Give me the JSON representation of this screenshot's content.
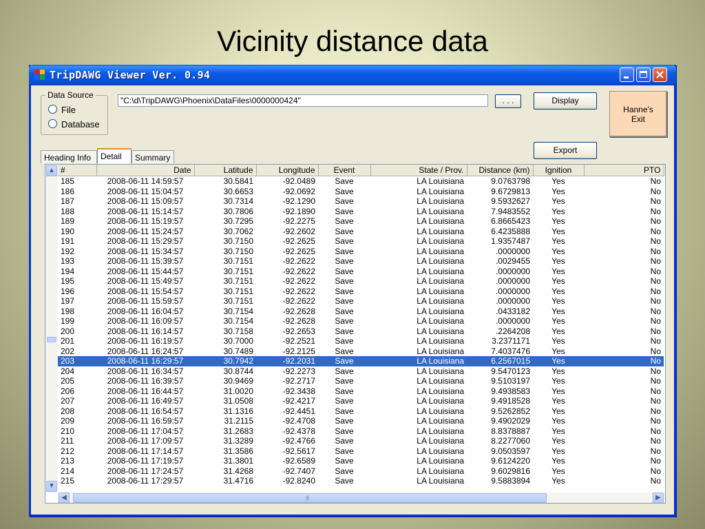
{
  "slide_title": "Vicinity distance data",
  "window": {
    "title": "TripDAWG Viewer  Ver. 0.94",
    "controls": {
      "minimize": "minimize-icon",
      "maximize": "maximize-icon",
      "close": "close-icon"
    }
  },
  "data_source": {
    "label": "Data Source",
    "options": [
      "File",
      "Database"
    ]
  },
  "path_input": {
    "value": "\"C:\\d\\TripDAWG\\Phoenix\\DataFiles\\0000000424\""
  },
  "buttons": {
    "browse": ". . .",
    "display": "Display",
    "exit": "Hanne's Exit",
    "export": "Export"
  },
  "tabs": [
    "Heading Info",
    "Detail",
    "Summary"
  ],
  "active_tab": "Detail",
  "colors": {
    "selection": "#316ac5",
    "exit_button": "#fcd9b6",
    "titlebar": "#0a5fe6"
  },
  "table": {
    "columns": [
      "#",
      "Date",
      "Latitude",
      "Longitude",
      "Event",
      "State / Prov.",
      "Distance (km)",
      "Ignition",
      "PTO"
    ],
    "selected_row": "203",
    "rows": [
      [
        "185",
        "2008-06-11 14:59:57",
        "30.5841",
        "-92.0489",
        "Save",
        "LA Louisiana",
        "9.0763798",
        "Yes",
        "No"
      ],
      [
        "186",
        "2008-06-11 15:04:57",
        "30.6653",
        "-92.0692",
        "Save",
        "LA Louisiana",
        "9.6729813",
        "Yes",
        "No"
      ],
      [
        "187",
        "2008-06-11 15:09:57",
        "30.7314",
        "-92.1290",
        "Save",
        "LA Louisiana",
        "9.5932627",
        "Yes",
        "No"
      ],
      [
        "188",
        "2008-06-11 15:14:57",
        "30.7806",
        "-92.1890",
        "Save",
        "LA Louisiana",
        "7.9483552",
        "Yes",
        "No"
      ],
      [
        "189",
        "2008-06-11 15:19:57",
        "30.7295",
        "-92.2275",
        "Save",
        "LA Louisiana",
        "6.8665423",
        "Yes",
        "No"
      ],
      [
        "190",
        "2008-06-11 15:24:57",
        "30.7062",
        "-92.2602",
        "Save",
        "LA Louisiana",
        "6.4235888",
        "Yes",
        "No"
      ],
      [
        "191",
        "2008-06-11 15:29:57",
        "30.7150",
        "-92.2625",
        "Save",
        "LA Louisiana",
        "1.9357487",
        "Yes",
        "No"
      ],
      [
        "192",
        "2008-06-11 15:34:57",
        "30.7150",
        "-92.2625",
        "Save",
        "LA Louisiana",
        ".0000000",
        "Yes",
        "No"
      ],
      [
        "193",
        "2008-06-11 15:39:57",
        "30.7151",
        "-92.2622",
        "Save",
        "LA Louisiana",
        ".0029455",
        "Yes",
        "No"
      ],
      [
        "194",
        "2008-06-11 15:44:57",
        "30.7151",
        "-92.2622",
        "Save",
        "LA Louisiana",
        ".0000000",
        "Yes",
        "No"
      ],
      [
        "195",
        "2008-06-11 15:49:57",
        "30.7151",
        "-92.2622",
        "Save",
        "LA Louisiana",
        ".0000000",
        "Yes",
        "No"
      ],
      [
        "196",
        "2008-06-11 15:54:57",
        "30.7151",
        "-92.2622",
        "Save",
        "LA Louisiana",
        ".0000000",
        "Yes",
        "No"
      ],
      [
        "197",
        "2008-06-11 15:59:57",
        "30.7151",
        "-92.2622",
        "Save",
        "LA Louisiana",
        ".0000000",
        "Yes",
        "No"
      ],
      [
        "198",
        "2008-06-11 16:04:57",
        "30.7154",
        "-92.2628",
        "Save",
        "LA Louisiana",
        ".0433182",
        "Yes",
        "No"
      ],
      [
        "199",
        "2008-06-11 16:09:57",
        "30.7154",
        "-92.2628",
        "Save",
        "LA Louisiana",
        ".0000000",
        "Yes",
        "No"
      ],
      [
        "200",
        "2008-06-11 16:14:57",
        "30.7158",
        "-92.2653",
        "Save",
        "LA Louisiana",
        ".2264208",
        "Yes",
        "No"
      ],
      [
        "201",
        "2008-06-11 16:19:57",
        "30.7000",
        "-92.2521",
        "Save",
        "LA Louisiana",
        "3.2371171",
        "Yes",
        "No"
      ],
      [
        "202",
        "2008-06-11 16:24:57",
        "30.7489",
        "-92.2125",
        "Save",
        "LA Louisiana",
        "7.4037476",
        "Yes",
        "No"
      ],
      [
        "203",
        "2008-06-11 16:29:57",
        "30.7942",
        "-92.2031",
        "Save",
        "LA Louisiana",
        "6.2567015",
        "Yes",
        "No"
      ],
      [
        "204",
        "2008-06-11 16:34:57",
        "30.8744",
        "-92.2273",
        "Save",
        "LA Louisiana",
        "9.5470123",
        "Yes",
        "No"
      ],
      [
        "205",
        "2008-06-11 16:39:57",
        "30.9469",
        "-92.2717",
        "Save",
        "LA Louisiana",
        "9.5103197",
        "Yes",
        "No"
      ],
      [
        "206",
        "2008-06-11 16:44:57",
        "31.0020",
        "-92.3438",
        "Save",
        "LA Louisiana",
        "9.4938583",
        "Yes",
        "No"
      ],
      [
        "207",
        "2008-06-11 16:49:57",
        "31.0508",
        "-92.4217",
        "Save",
        "LA Louisiana",
        "9.4918528",
        "Yes",
        "No"
      ],
      [
        "208",
        "2008-06-11 16:54:57",
        "31.1316",
        "-92.4451",
        "Save",
        "LA Louisiana",
        "9.5262852",
        "Yes",
        "No"
      ],
      [
        "209",
        "2008-06-11 16:59:57",
        "31.2115",
        "-92.4708",
        "Save",
        "LA Louisiana",
        "9.4902029",
        "Yes",
        "No"
      ],
      [
        "210",
        "2008-06-11 17:04:57",
        "31.2683",
        "-92.4378",
        "Save",
        "LA Louisiana",
        "8.8378887",
        "Yes",
        "No"
      ],
      [
        "211",
        "2008-06-11 17:09:57",
        "31.3289",
        "-92.4766",
        "Save",
        "LA Louisiana",
        "8.2277060",
        "Yes",
        "No"
      ],
      [
        "212",
        "2008-06-11 17:14:57",
        "31.3586",
        "-92.5617",
        "Save",
        "LA Louisiana",
        "9.0503597",
        "Yes",
        "No"
      ],
      [
        "213",
        "2008-06-11 17:19:57",
        "31.3801",
        "-92.6589",
        "Save",
        "LA Louisiana",
        "9.6124220",
        "Yes",
        "No"
      ],
      [
        "214",
        "2008-06-11 17:24:57",
        "31.4268",
        "-92.7407",
        "Save",
        "LA Louisiana",
        "9.6029816",
        "Yes",
        "No"
      ],
      [
        "215",
        "2008-06-11 17:29:57",
        "31.4716",
        "-92.8240",
        "Save",
        "LA Louisiana",
        "9.5883894",
        "Yes",
        "No"
      ]
    ]
  }
}
